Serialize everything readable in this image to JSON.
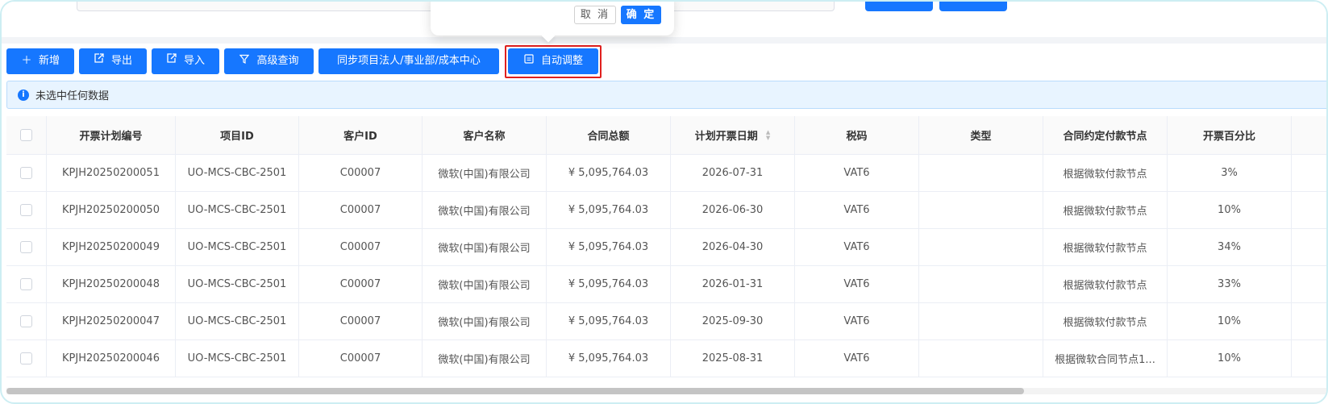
{
  "popconfirm": {
    "cancel": "取 消",
    "ok": "确 定"
  },
  "toolbar": {
    "add": "新增",
    "export": "导出",
    "import": "导入",
    "advanced_query": "高级查询",
    "sync": "同步项目法人/事业部/成本中心",
    "auto_adjust": "自动调整"
  },
  "info": {
    "text": "未选中任何数据"
  },
  "table": {
    "headers": [
      "开票计划编号",
      "项目ID",
      "客户ID",
      "客户名称",
      "合同总额",
      "计划开票日期",
      "税码",
      "类型",
      "合同约定付款节点",
      "开票百分比"
    ],
    "rows": [
      [
        "KPJH20250200051",
        "UO-MCS-CBC-2501",
        "C00007",
        "微软(中国)有限公司",
        "¥ 5,095,764.03",
        "2026-07-31",
        "VAT6",
        "",
        "根据微软付款节点",
        "3%"
      ],
      [
        "KPJH20250200050",
        "UO-MCS-CBC-2501",
        "C00007",
        "微软(中国)有限公司",
        "¥ 5,095,764.03",
        "2026-06-30",
        "VAT6",
        "",
        "根据微软付款节点",
        "10%"
      ],
      [
        "KPJH20250200049",
        "UO-MCS-CBC-2501",
        "C00007",
        "微软(中国)有限公司",
        "¥ 5,095,764.03",
        "2026-04-30",
        "VAT6",
        "",
        "根据微软付款节点",
        "34%"
      ],
      [
        "KPJH20250200048",
        "UO-MCS-CBC-2501",
        "C00007",
        "微软(中国)有限公司",
        "¥ 5,095,764.03",
        "2026-01-31",
        "VAT6",
        "",
        "根据微软付款节点",
        "33%"
      ],
      [
        "KPJH20250200047",
        "UO-MCS-CBC-2501",
        "C00007",
        "微软(中国)有限公司",
        "¥ 5,095,764.03",
        "2025-09-30",
        "VAT6",
        "",
        "根据微软付款节点",
        "10%"
      ],
      [
        "KPJH20250200046",
        "UO-MCS-CBC-2501",
        "C00007",
        "微软(中国)有限公司",
        "¥ 5,095,764.03",
        "2025-08-31",
        "VAT6",
        "",
        "根据微软合同节点1...",
        "10%"
      ]
    ]
  },
  "colors": {
    "primary": "#1677ff",
    "highlight": "#e0201e",
    "info_bg": "#e8f4ff"
  },
  "icons": {
    "add": "plus-icon",
    "export": "export-icon",
    "import": "import-icon",
    "advanced_query": "filter-icon",
    "auto_adjust": "calendar-icon",
    "info": "info-icon"
  }
}
